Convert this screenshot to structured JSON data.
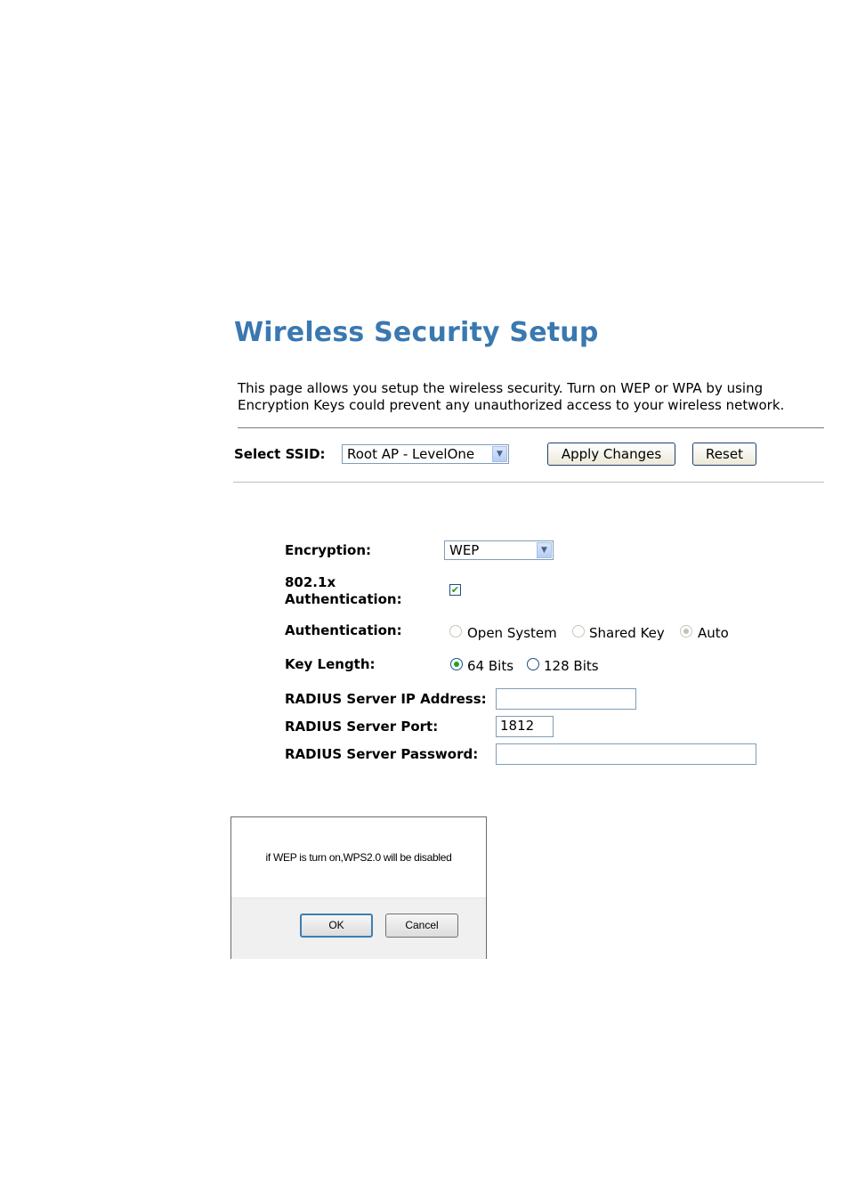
{
  "page": {
    "title": "Wireless Security Setup",
    "description_line1": "This page allows you setup the wireless security. Turn on WEP or WPA by using",
    "description_line2": "Encryption Keys could prevent any unauthorized access to your wireless network."
  },
  "ssid": {
    "label": "Select SSID:",
    "selected": "Root AP - LevelOne",
    "apply_label": "Apply Changes",
    "reset_label": "Reset"
  },
  "form": {
    "encryption": {
      "label": "Encryption:",
      "selected": "WEP"
    },
    "auth8021x": {
      "label_line1": "802.1x",
      "label_line2": "Authentication:",
      "checked": true
    },
    "authentication": {
      "label": "Authentication:",
      "options": [
        {
          "label": "Open System",
          "selected": false,
          "enabled": false
        },
        {
          "label": "Shared Key",
          "selected": false,
          "enabled": false
        },
        {
          "label": "Auto",
          "selected": true,
          "enabled": false
        }
      ]
    },
    "key_length": {
      "label": "Key Length:",
      "options": [
        {
          "label": "64 Bits",
          "selected": true
        },
        {
          "label": "128 Bits",
          "selected": false
        }
      ]
    },
    "radius_ip": {
      "label": "RADIUS Server IP Address:",
      "value": ""
    },
    "radius_port": {
      "label": "RADIUS Server Port:",
      "value": "1812"
    },
    "radius_password": {
      "label": "RADIUS Server Password:",
      "value": ""
    }
  },
  "dialog": {
    "message": "if WEP is turn on,WPS2.0 will be disabled",
    "ok_label": "OK",
    "cancel_label": "Cancel"
  },
  "colors": {
    "title": "#3a78b0",
    "check_accent": "#21a121"
  },
  "icons": {
    "dropdown": "chevron-down-icon",
    "checkmark": "checkmark-icon"
  }
}
